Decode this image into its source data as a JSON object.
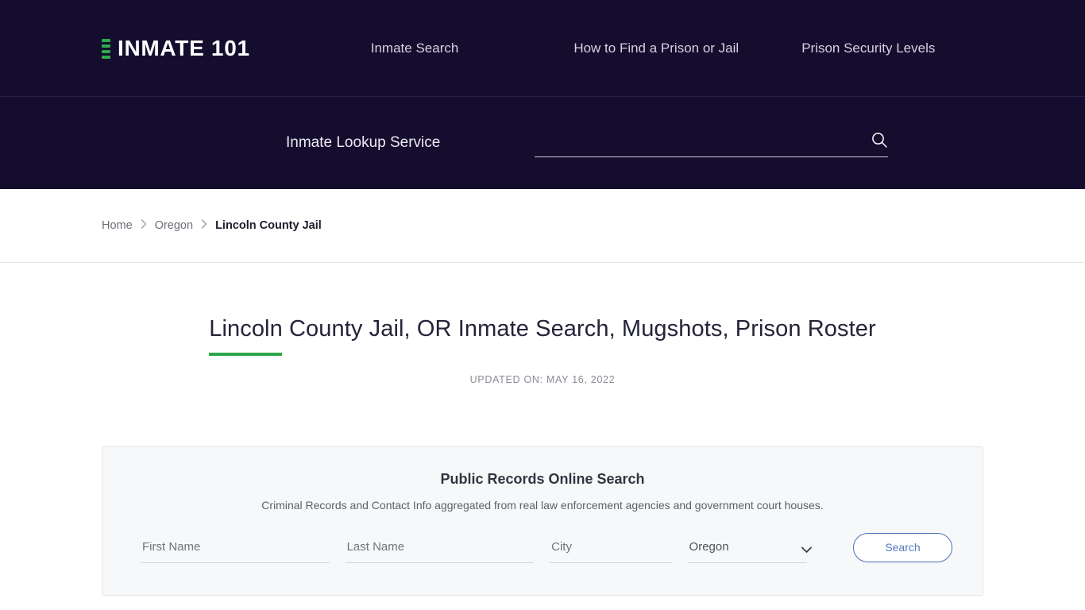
{
  "header": {
    "brand": {
      "name": "INMATE 101",
      "bar_count": 4,
      "bar_color": "#2eaa4a"
    },
    "nav": [
      {
        "label": "Inmate Search"
      },
      {
        "label": "How to Find a Prison or Jail"
      },
      {
        "label": "Prison Security Levels"
      }
    ],
    "lookup_label": "Inmate Lookup Service",
    "search": {
      "value": "",
      "placeholder": ""
    }
  },
  "breadcrumb": {
    "items": [
      {
        "label": "Home",
        "current": false
      },
      {
        "label": "Oregon",
        "current": false
      },
      {
        "label": "Lincoln County Jail",
        "current": true
      }
    ],
    "separator": "›"
  },
  "page": {
    "title": "Lincoln County Jail, OR Inmate Search, Mugshots, Prison Roster",
    "updated": "UPDATED ON: MAY 16, 2022",
    "accent_color": "#2ea84a"
  },
  "records_card": {
    "title": "Public Records Online Search",
    "subtitle": "Criminal Records and Contact Info aggregated from real law enforcement agencies and government court houses.",
    "fields": {
      "first_name": {
        "placeholder": "First Name",
        "value": ""
      },
      "last_name": {
        "placeholder": "Last Name",
        "value": ""
      },
      "city": {
        "placeholder": "City",
        "value": ""
      },
      "state": {
        "selected": "Oregon",
        "options": [
          "Oregon"
        ]
      }
    },
    "submit_label": "Search",
    "accent_color": "#4a72b5"
  },
  "theme": {
    "header_bg": "#150d2e",
    "card_bg": "#f7f8f9",
    "page_bg": "#ffffff"
  }
}
